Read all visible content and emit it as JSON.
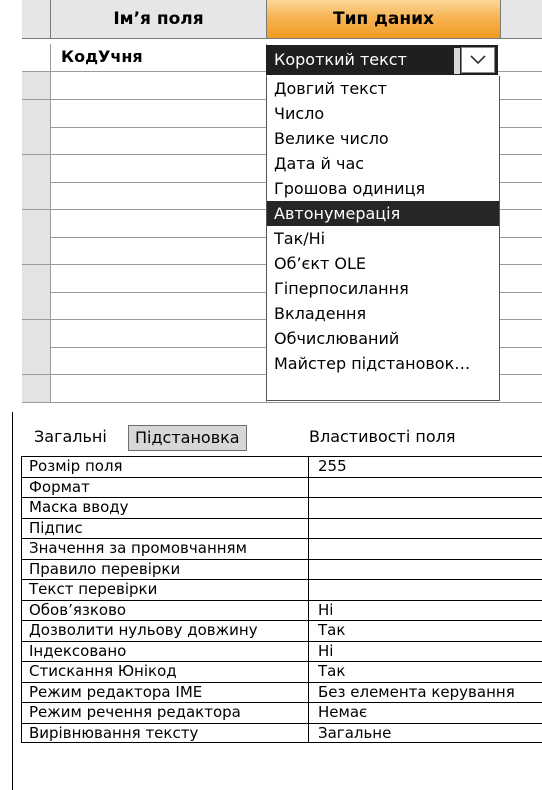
{
  "grid": {
    "col_name": "Ім’я поля",
    "col_type": "Тип даних",
    "first_field_name": "КодУчня",
    "empty_rows": 12
  },
  "combo": {
    "value": "Короткий текст",
    "icon": "chevron-down-icon"
  },
  "dropdown": {
    "options": [
      "Довгий текст",
      "Число",
      "Велике число",
      "Дата й час",
      "Грошова одиниця",
      "Автонумерація",
      "Так/Ні",
      "Об’єкт OLE",
      "Гіперпосилання",
      "Вкладення",
      "Обчислюваний",
      "Майстер підстановок…"
    ],
    "selected_index": 5
  },
  "tabs": {
    "general": "Загальні",
    "lookup": "Підстановка"
  },
  "properties_title": "Властивості поля",
  "properties": [
    {
      "name": "Розмір поля",
      "value": "255"
    },
    {
      "name": "Формат",
      "value": ""
    },
    {
      "name": "Маска вводу",
      "value": ""
    },
    {
      "name": "Підпис",
      "value": ""
    },
    {
      "name": "Значення за промовчанням",
      "value": ""
    },
    {
      "name": "Правило перевірки",
      "value": ""
    },
    {
      "name": "Текст перевірки",
      "value": ""
    },
    {
      "name": "Обов’язково",
      "value": "Ні"
    },
    {
      "name": "Дозволити нульову довжину",
      "value": "Так"
    },
    {
      "name": "Індексовано",
      "value": "Ні"
    },
    {
      "name": "Стискання Юнікод",
      "value": "Так"
    },
    {
      "name": "Режим редактора IME",
      "value": "Без елемента керування"
    },
    {
      "name": "Режим речення редактора",
      "value": "Немає"
    },
    {
      "name": "Вирівнювання тексту",
      "value": "Загальне"
    }
  ]
}
